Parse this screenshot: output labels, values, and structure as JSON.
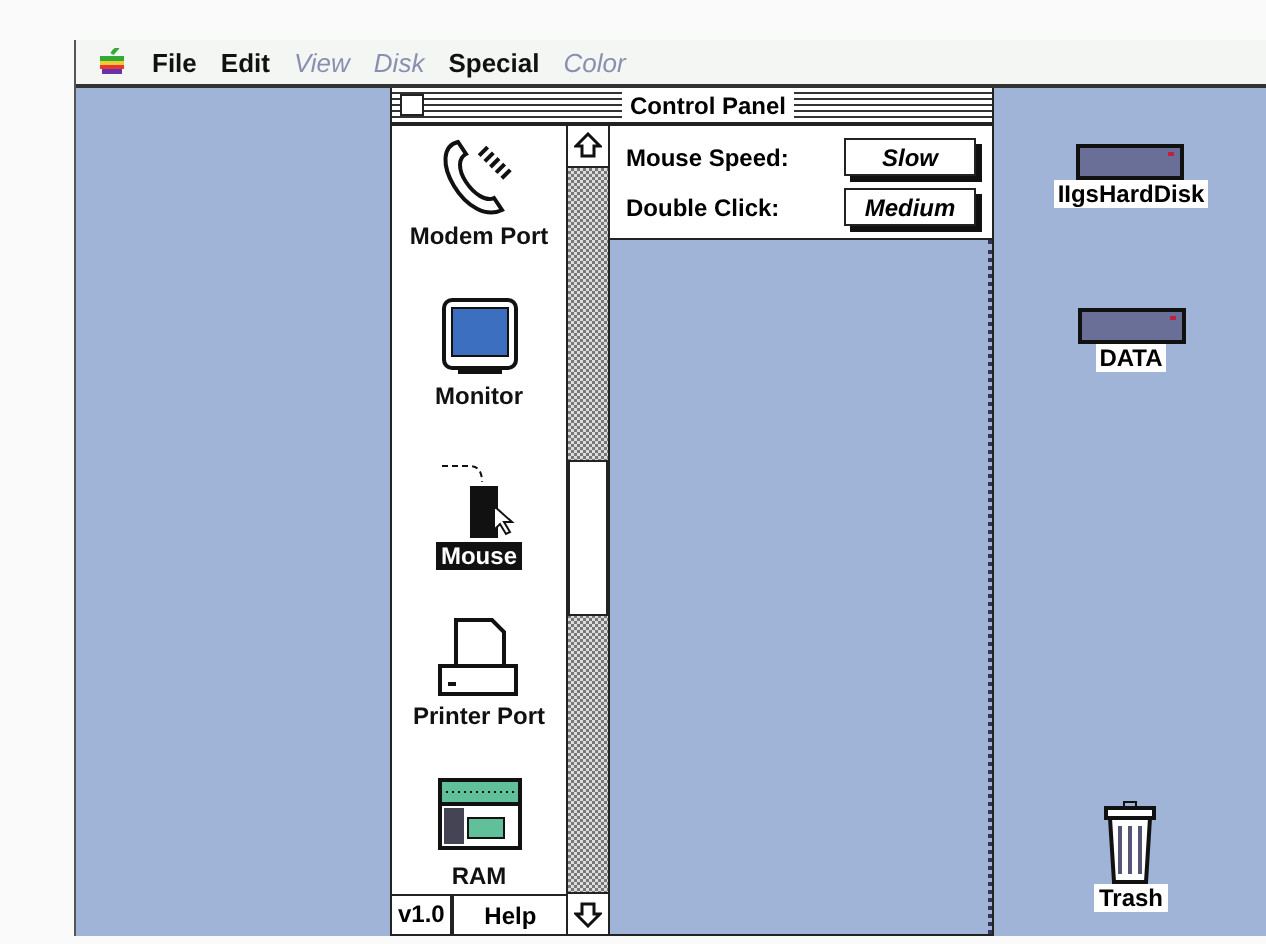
{
  "menu_bar": {
    "items": [
      {
        "label": "File",
        "disabled": false
      },
      {
        "label": "Edit",
        "disabled": false
      },
      {
        "label": "View",
        "disabled": true
      },
      {
        "label": "Disk",
        "disabled": true
      },
      {
        "label": "Special",
        "disabled": false
      },
      {
        "label": "Color",
        "disabled": true
      }
    ]
  },
  "control_panel": {
    "title": "Control Panel",
    "items": [
      {
        "kind": "modem",
        "label": "Modem Port",
        "selected": false
      },
      {
        "kind": "monitor",
        "label": "Monitor",
        "selected": false
      },
      {
        "kind": "mouse",
        "label": "Mouse",
        "selected": true
      },
      {
        "kind": "printer",
        "label": "Printer Port",
        "selected": false
      },
      {
        "kind": "ram",
        "label": "RAM",
        "selected": false
      }
    ],
    "settings": [
      {
        "label": "Mouse Speed:",
        "value": "Slow"
      },
      {
        "label": "Double Click:",
        "value": "Medium"
      }
    ],
    "version": "v1.0",
    "help": "Help"
  },
  "desktop_icons": [
    {
      "kind": "disk",
      "label": "IIgsHardDisk"
    },
    {
      "kind": "disk",
      "label": "DATA"
    },
    {
      "kind": "trash",
      "label": "Trash"
    }
  ]
}
